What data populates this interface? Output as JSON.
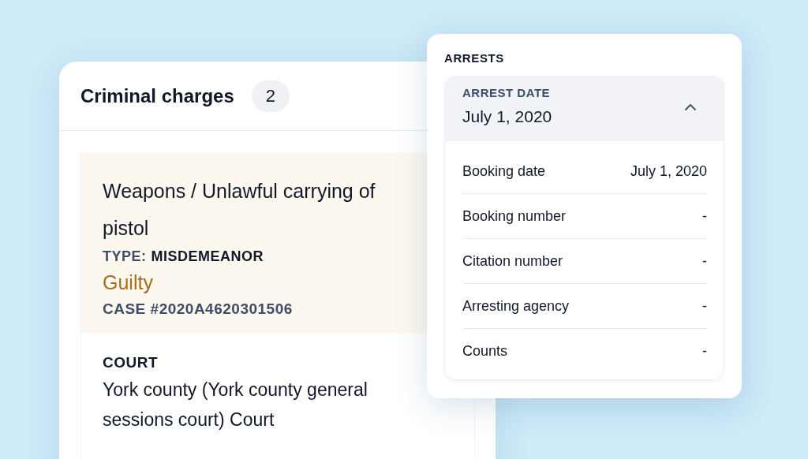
{
  "charges_card": {
    "title": "Criminal charges",
    "count": "2",
    "charge": {
      "title": "Weapons / Unlawful carrying of pistol",
      "type_label": "TYPE:",
      "type_value": "MISDEMEANOR",
      "verdict": "Guilty",
      "case": "CASE #2020A4620301506",
      "court_label": "COURT",
      "court_value": "York county (York county general sessions court) Court"
    }
  },
  "arrests_card": {
    "title": "ARRESTS",
    "arrest": {
      "date_label": "ARREST DATE",
      "date": "July 1, 2020",
      "expanded": true,
      "details": [
        {
          "label": "Booking date",
          "value": "July 1, 2020"
        },
        {
          "label": "Booking number",
          "value": "-"
        },
        {
          "label": "Citation number",
          "value": "-"
        },
        {
          "label": "Arresting agency",
          "value": "-"
        },
        {
          "label": "Counts",
          "value": "-"
        }
      ]
    }
  }
}
